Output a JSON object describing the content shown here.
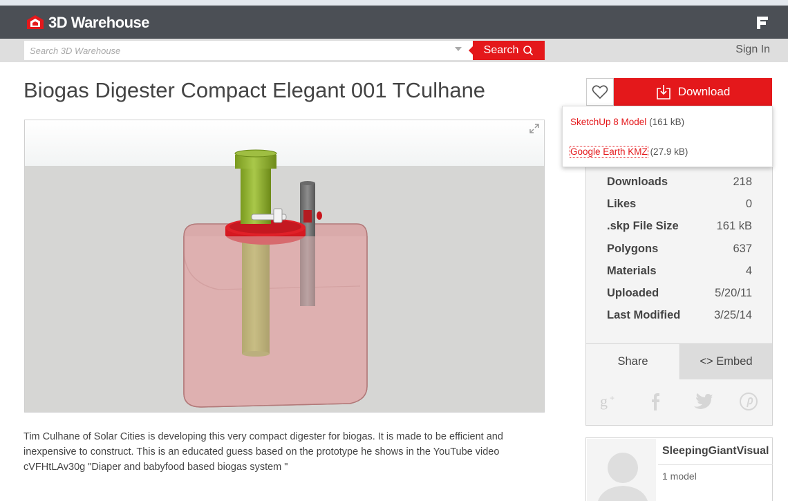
{
  "header": {
    "brand": "3D Warehouse",
    "logo_icon": "warehouse-logo-icon",
    "menu_icon": "menu-icon"
  },
  "search": {
    "placeholder": "Search 3D Warehouse",
    "button_label": "Search",
    "sign_in": "Sign In"
  },
  "model": {
    "title": "Biogas Digester Compact Elegant 001 TCulhane",
    "description": "Tim Culhane of Solar Cities is developing this very compact digester for biogas. It is made to be efficient and inexpensive to construct. This is an educated guess based on the prototype he shows in the YouTube video cVFHtLAv30g \"Diaper and babyfood based biogas system \""
  },
  "download": {
    "button_label": "Download",
    "options": [
      {
        "label": "SketchUp 8 Model",
        "size": "(161 kB)"
      },
      {
        "label": "Google Earth KMZ",
        "size": "(27.9 kB)"
      }
    ]
  },
  "stats": [
    {
      "label": "Downloads",
      "value": "218"
    },
    {
      "label": "Likes",
      "value": "0"
    },
    {
      "label": ".skp File Size",
      "value": "161 kB"
    },
    {
      "label": "Polygons",
      "value": "637"
    },
    {
      "label": "Materials",
      "value": "4"
    },
    {
      "label": "Uploaded",
      "value": "5/20/11"
    },
    {
      "label": "Last Modified",
      "value": "3/25/14"
    }
  ],
  "share": {
    "share_tab": "Share",
    "embed_tab": "<> Embed",
    "icons": [
      "google-plus-icon",
      "facebook-icon",
      "twitter-icon",
      "pinterest-icon"
    ]
  },
  "author": {
    "name": "SleepingGiantVisual",
    "models": "1 model"
  },
  "colors": {
    "brand_red": "#e4181b",
    "header_bg": "#4b4f55"
  }
}
